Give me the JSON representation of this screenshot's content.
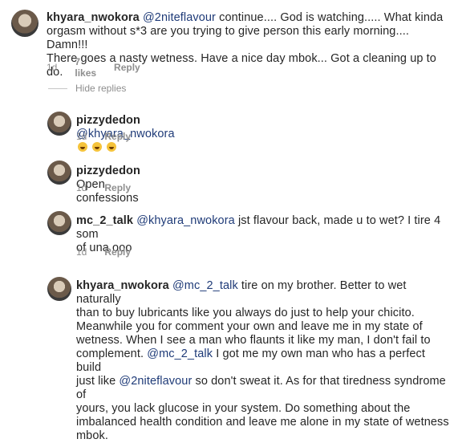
{
  "comments": [
    {
      "username": "khyara_nwokora",
      "mention": "@2nitefl avour",
      "body_lines": [
        " continue.... God is watching..... What kinda",
        "orgasm without s*3 are you trying to give person this early morning.... Damn!!!",
        "There goes a nasty wetness. Have a nice day mbok... Got a cleaning up to do."
      ],
      "time": "1d",
      "likes": "7 likes",
      "reply": "Reply"
    }
  ],
  "hide_replies": "Hide replies",
  "replies": [
    {
      "username": "pizzydedon",
      "mention": "@khyara_nwokora",
      "text": "",
      "emoji_count": 3,
      "time": "1d",
      "reply": "Reply"
    },
    {
      "username": "pizzydedon",
      "mention": "",
      "text": "Open confessions",
      "time": "1d",
      "reply": "Reply"
    },
    {
      "username": "mc_2_talk",
      "mention": "@khyara_nwokora",
      "text_line1": "  jst flavour back, made u to wet? I tire 4 som",
      "text_line2": "of una ooo",
      "time": "1d",
      "reply": "Reply"
    },
    {
      "username": "khyara_nwokora",
      "mention1": "@mc_2_talk",
      "line1": " tire on my brother. Better to wet naturally",
      "line2": "than to buy lubricants like you always do just to help your chicito.",
      "line3": "Meanwhile you for comment your own and leave me in my state of",
      "line4": "wetness. When I see a man who  flaunts it like my man, I don't fail to",
      "line5": "complement. ",
      "mention2": "@mc_2_talk",
      "line5b": " I got me my own man who has a perfect build",
      "line6a": "just like ",
      "mention3": "@2niteflavour",
      "line6b": " so don't sweat it. As for that tiredness syndrome of",
      "line7": "yours, you lack glucose in your system. Do something about the",
      "line8": "imbalanced health condition and leave me alone in my state of wetness",
      "line9": "mbok."
    }
  ]
}
